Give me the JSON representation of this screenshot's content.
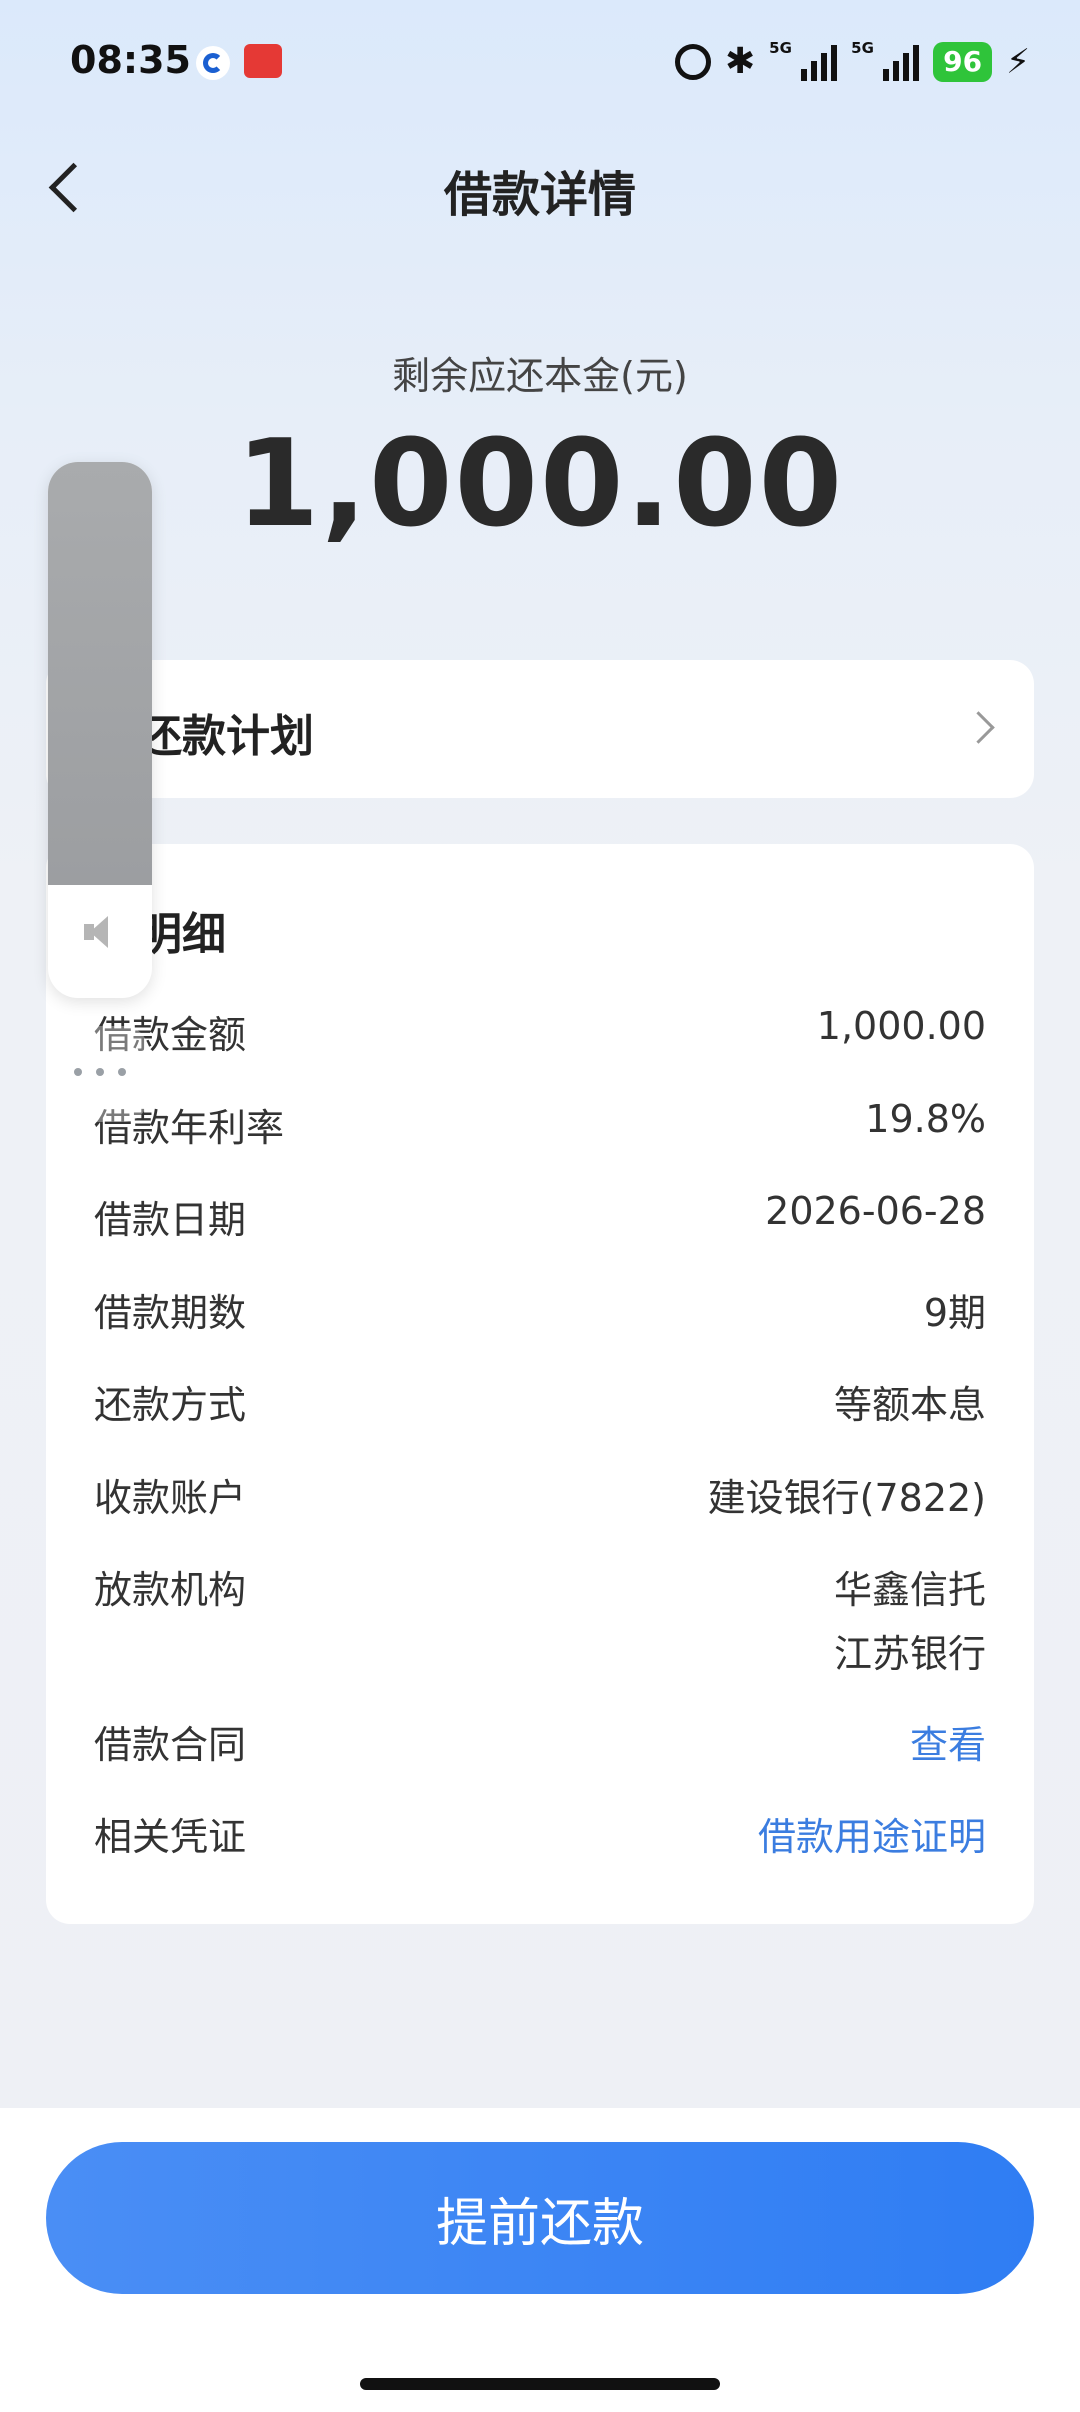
{
  "status_bar": {
    "time": "08:35",
    "network_1": "5G",
    "network_2": "5G",
    "battery": "96"
  },
  "nav": {
    "title": "借款详情"
  },
  "summary": {
    "label": "剩余应还本金(元)",
    "amount": "1,000.00"
  },
  "plan": {
    "label": "看还款计划"
  },
  "details": {
    "title": "款明细",
    "rows": [
      {
        "label": "借款金额",
        "value": "1,000.00"
      },
      {
        "label": "借款年利率",
        "value": "19.8%"
      },
      {
        "label": "借款日期",
        "value": "2026-06-28"
      },
      {
        "label": "借款期数",
        "value": "9期"
      },
      {
        "label": "还款方式",
        "value": "等额本息"
      },
      {
        "label": "收款账户",
        "value": "建设银行(7822)"
      },
      {
        "label": "放款机构",
        "value": "华鑫信托",
        "value2": "江苏银行"
      },
      {
        "label": "借款合同",
        "value": "查看"
      },
      {
        "label": "相关凭证",
        "value": "借款用途证明"
      }
    ]
  },
  "volume": {
    "level": 0.79
  },
  "footer": {
    "button": "提前还款"
  },
  "colors": {
    "accent": "#3b7de0",
    "button": "#3b86f4",
    "battery": "#2fc43a"
  }
}
